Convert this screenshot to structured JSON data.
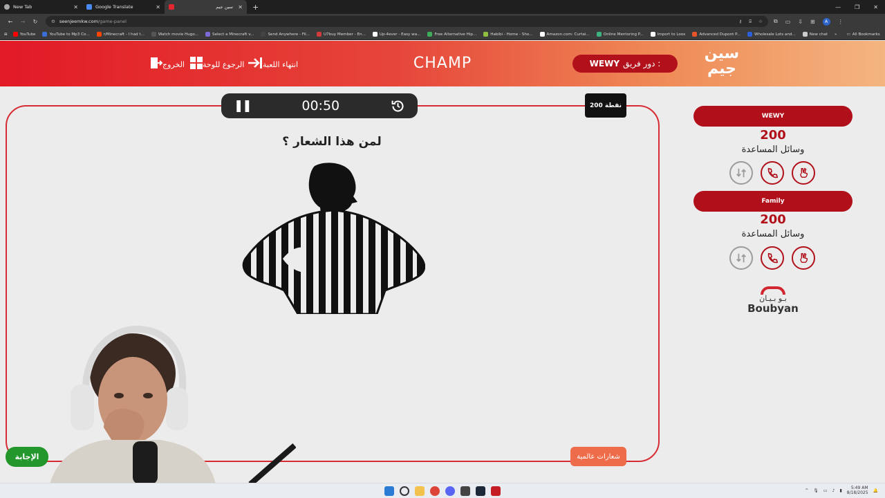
{
  "browser": {
    "tabs": [
      {
        "label": "New Tab",
        "active": false
      },
      {
        "label": "Google Translate",
        "active": false
      },
      {
        "label": "سين جيم",
        "active": true
      }
    ],
    "url_host": "seenjeemkw.com",
    "url_path": "/game-panel",
    "profile_initial": "A",
    "bookmarks": [
      {
        "label": "YouTube",
        "color": "#ff0000"
      },
      {
        "label": "YouTube to Mp3 Co...",
        "color": "#3b6fd6"
      },
      {
        "label": "r/Minecraft - I had t...",
        "color": "#ff4500"
      },
      {
        "label": "Watch movie Hugo...",
        "color": "#555555"
      },
      {
        "label": "Select a Minecraft v...",
        "color": "#7c6bd6"
      },
      {
        "label": "Send Anywhere - Fil...",
        "color": "#444444"
      },
      {
        "label": "U7buy Member - En...",
        "color": "#d23b3b"
      },
      {
        "label": "Up-4ever - Easy wa...",
        "color": "#ffffff"
      },
      {
        "label": "Free Alternative Hip...",
        "color": "#3fae5a"
      },
      {
        "label": "Habibi - Home - Sho...",
        "color": "#8fbf3f"
      },
      {
        "label": "Amazon.com: Curtai...",
        "color": "#ffffff"
      },
      {
        "label": "Online Mentoring P...",
        "color": "#3fb37f"
      },
      {
        "label": "Import to Loox",
        "color": "#ffffff"
      },
      {
        "label": "Advanced Dupont P...",
        "color": "#e8542a"
      },
      {
        "label": "Wholesale Lots and...",
        "color": "#2b5fd9"
      },
      {
        "label": "New chat",
        "color": "#cccccc"
      }
    ],
    "all_bookmarks_label": "All Bookmarks"
  },
  "header": {
    "exit_label": "الخروج",
    "board_label": "الرجوع للوحة",
    "end_game_label": "انتهاء اللعبة",
    "game_title": "CHAMP",
    "turn_prefix": "دور فريق :",
    "turn_team": "WEWY",
    "logo_text_top": "سين",
    "logo_text_bottom": "جيم"
  },
  "game": {
    "timer": "00:50",
    "points_label": "200 نقطة",
    "question": "لمن هذا الشعار ؟",
    "category": "شعارات عالمية",
    "answer_button": "الإجابة"
  },
  "teams": [
    {
      "name": "WEWY",
      "score": "200",
      "aids_label": "وسائل المساعدة"
    },
    {
      "name": "Family",
      "score": "200",
      "aids_label": "وسائل المساعدة"
    }
  ],
  "sponsor": {
    "arabic": "بـو بـيـان",
    "english": "Boubyan"
  },
  "taskbar": {
    "time": "5:49 AM",
    "date": "8/18/2025"
  },
  "colors": {
    "brand_red": "#b1101a",
    "board_border": "#d62b33",
    "category_orange": "#ef6c4a",
    "answer_green": "#23962c"
  }
}
